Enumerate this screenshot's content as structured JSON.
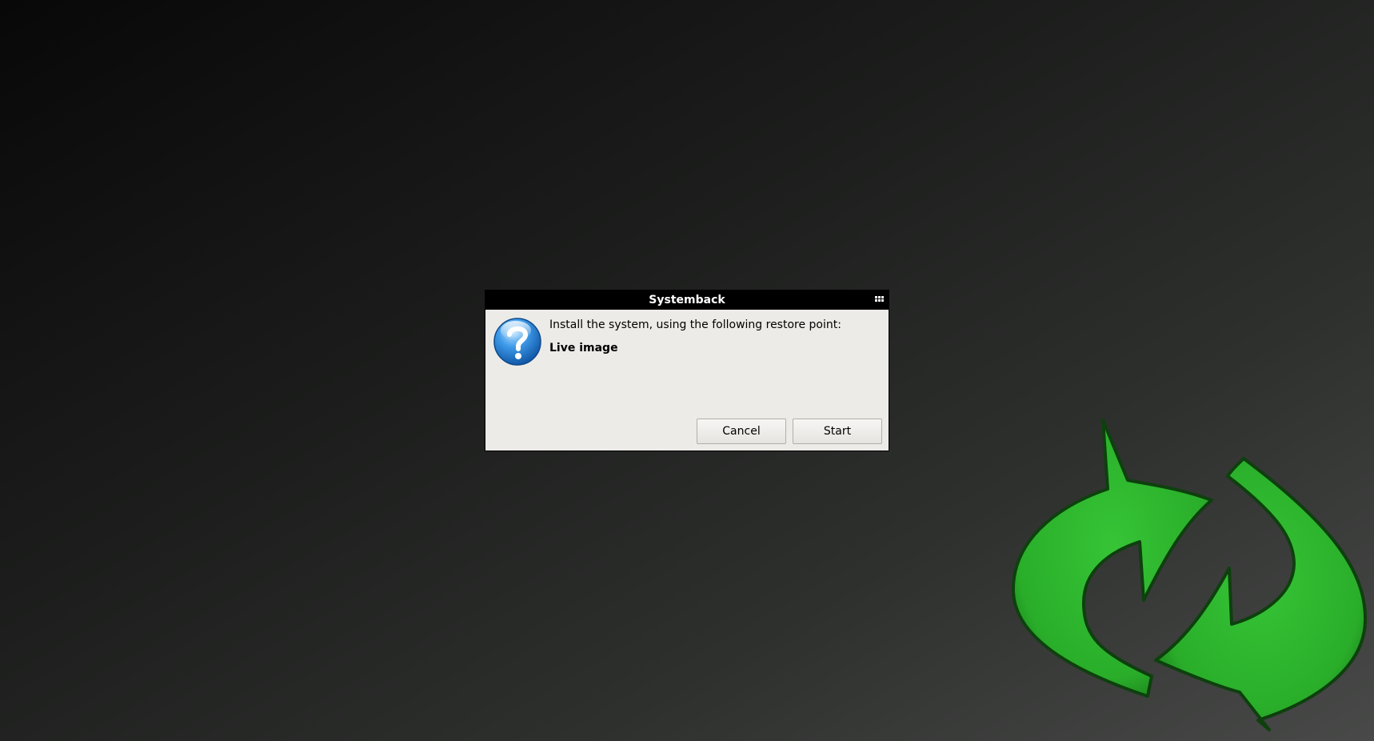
{
  "dialog": {
    "title": "Systemback",
    "message": "Install the system, using the following restore point:",
    "restore_point": "Live image",
    "cancel_label": "Cancel",
    "start_label": "Start"
  },
  "icons": {
    "menu": "window-menu-icon",
    "question": "question-icon",
    "logo": "systemback-logo"
  },
  "colors": {
    "dialog_bg": "#edebe7",
    "titlebar_bg": "#000000",
    "logo_green": "#2fb52f",
    "question_blue": "#2a83d6"
  }
}
